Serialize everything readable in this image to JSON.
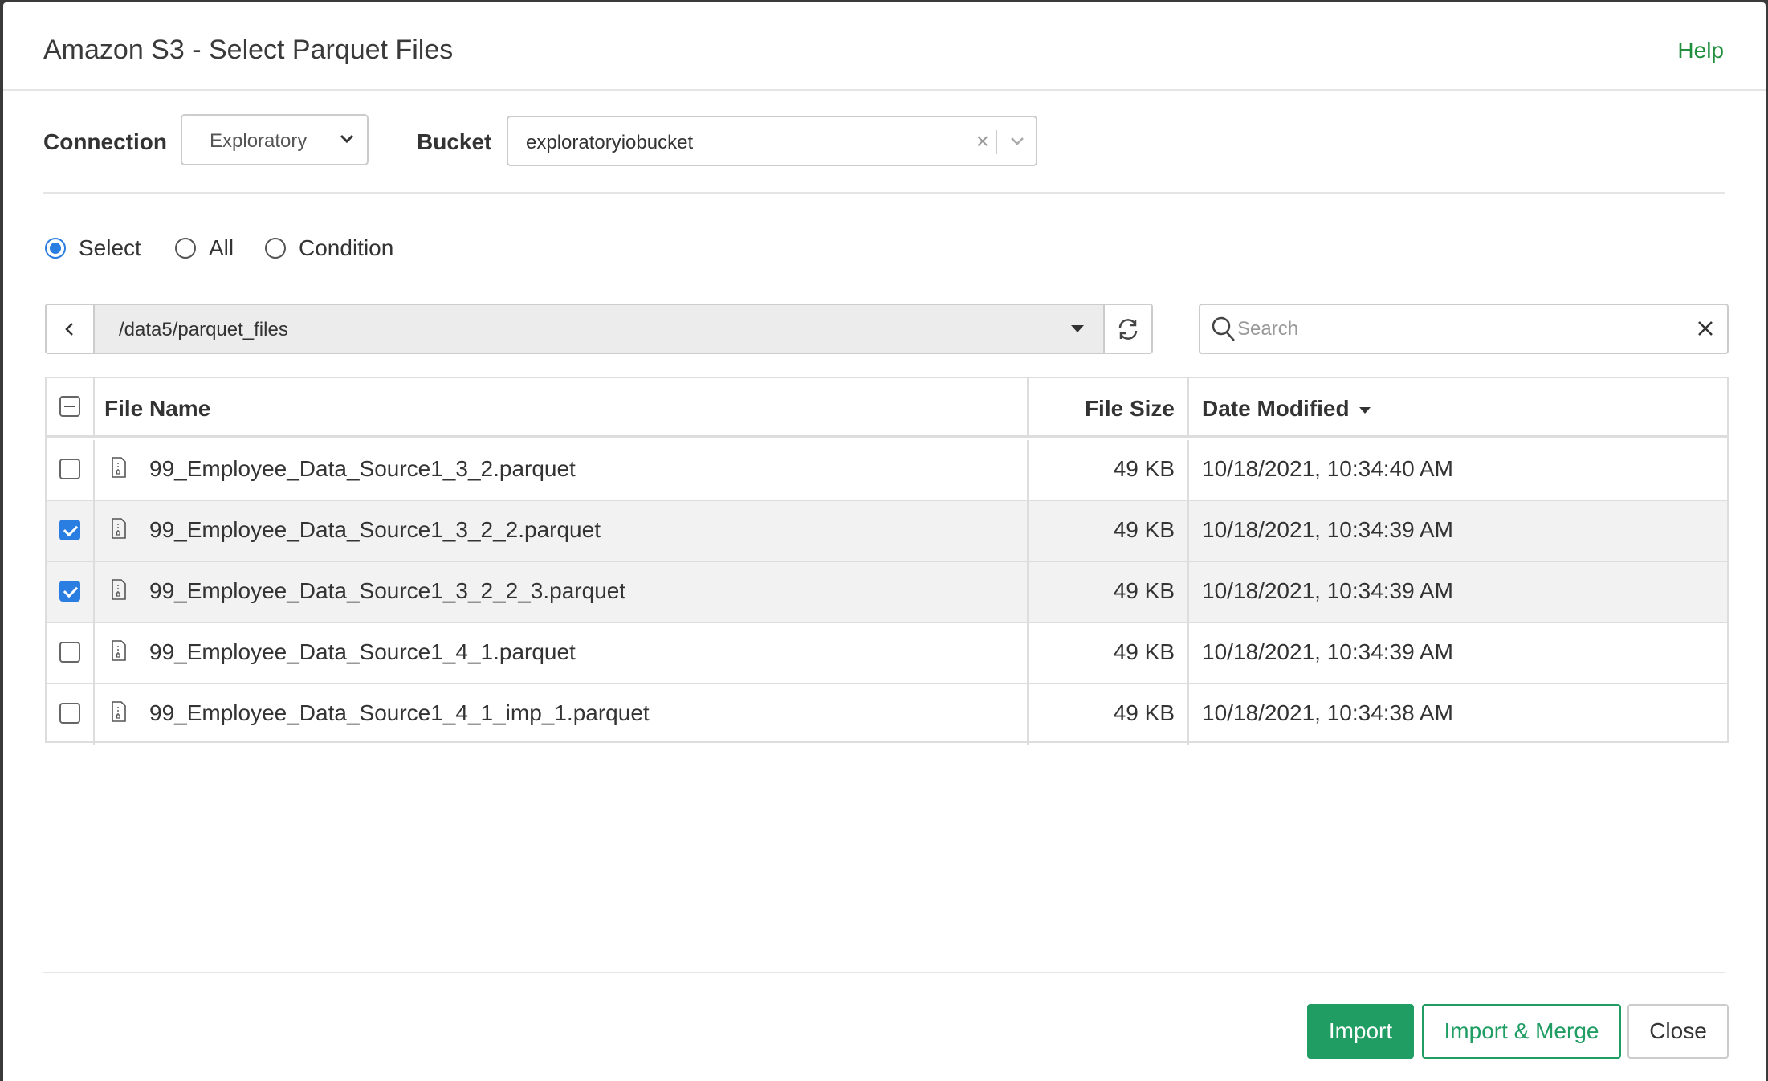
{
  "dialog": {
    "title": "Amazon S3 - Select Parquet Files",
    "help_label": "Help"
  },
  "connection": {
    "label": "Connection",
    "value": "Exploratory"
  },
  "bucket": {
    "label": "Bucket",
    "value": "exploratoryiobucket"
  },
  "mode": {
    "options": [
      "Select",
      "All",
      "Condition"
    ],
    "selected": "Select"
  },
  "path": {
    "value": "/data5/parquet_files"
  },
  "search": {
    "placeholder": "Search",
    "value": ""
  },
  "table": {
    "columns": [
      "File Name",
      "File Size",
      "Date Modified"
    ],
    "sorted_by": "Date Modified",
    "rows": [
      {
        "name": "99_Employee_Data_Source1_3_2.parquet",
        "size": "49 KB",
        "date": "10/18/2021, 10:34:40 AM",
        "checked": false
      },
      {
        "name": "99_Employee_Data_Source1_3_2_2.parquet",
        "size": "49 KB",
        "date": "10/18/2021, 10:34:39 AM",
        "checked": true
      },
      {
        "name": "99_Employee_Data_Source1_3_2_2_3.parquet",
        "size": "49 KB",
        "date": "10/18/2021, 10:34:39 AM",
        "checked": true
      },
      {
        "name": "99_Employee_Data_Source1_4_1.parquet",
        "size": "49 KB",
        "date": "10/18/2021, 10:34:39 AM",
        "checked": false
      },
      {
        "name": "99_Employee_Data_Source1_4_1_imp_1.parquet",
        "size": "49 KB",
        "date": "10/18/2021, 10:34:38 AM",
        "checked": false
      }
    ]
  },
  "footer": {
    "import_label": "Import",
    "import_merge_label": "Import & Merge",
    "close_label": "Close"
  },
  "colors": {
    "accent_green": "#1f9d63",
    "link_green": "#1f8f3e",
    "checkbox_blue": "#2a7de1"
  }
}
